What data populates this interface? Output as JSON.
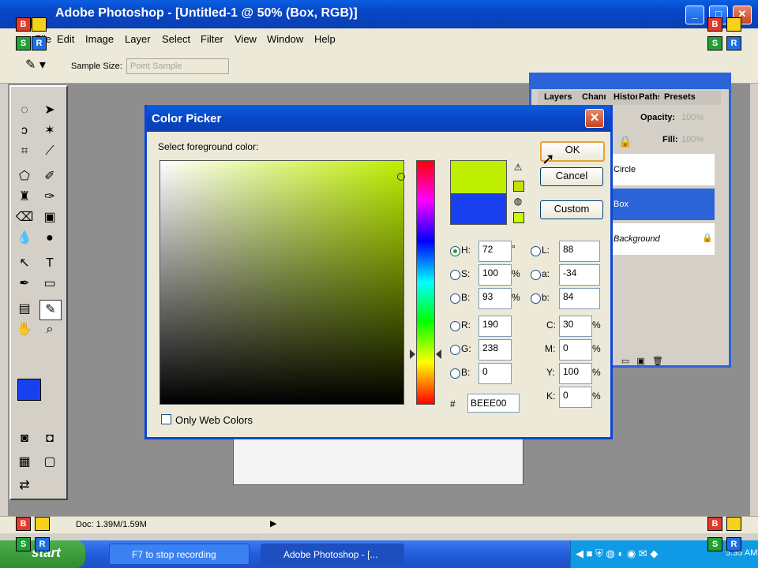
{
  "app": {
    "title": "Adobe Photoshop - [Untitled-1 @ 50% (Box, RGB)]",
    "menus": [
      "File",
      "Edit",
      "Image",
      "Layer",
      "Select",
      "Filter",
      "View",
      "Window",
      "Help"
    ],
    "options": {
      "sample_size_label": "Sample Size:",
      "sample_size_value": "Point Sample"
    },
    "status": {
      "doc": "Doc: 1.39M/1.59M"
    }
  },
  "layers_panel": {
    "tabs": [
      "Layers",
      "Channels",
      "History",
      "Paths",
      "Presets"
    ],
    "opacity_label": "Opacity:",
    "opacity_value": "100%",
    "fill_label": "Fill:",
    "fill_value": "100%",
    "layers": [
      "Circle",
      "Box",
      "Background"
    ]
  },
  "dialog": {
    "title": "Color Picker",
    "select_label": "Select foreground color:",
    "ok": "OK",
    "cancel": "Cancel",
    "custom": "Custom",
    "fields": {
      "h": {
        "label": "H:",
        "value": "72",
        "unit": "°"
      },
      "s": {
        "label": "S:",
        "value": "100",
        "unit": "%"
      },
      "b": {
        "label": "B:",
        "value": "93",
        "unit": "%"
      },
      "r": {
        "label": "R:",
        "value": "190"
      },
      "g": {
        "label": "G:",
        "value": "238"
      },
      "bl": {
        "label": "B:",
        "value": "0"
      },
      "l": {
        "label": "L:",
        "value": "88"
      },
      "a": {
        "label": "a:",
        "value": "-34"
      },
      "b2": {
        "label": "b:",
        "value": "84"
      },
      "c": {
        "label": "C:",
        "value": "30",
        "unit": "%"
      },
      "m": {
        "label": "M:",
        "value": "0",
        "unit": "%"
      },
      "y": {
        "label": "Y:",
        "value": "100",
        "unit": "%"
      },
      "k": {
        "label": "K:",
        "value": "0",
        "unit": "%"
      }
    },
    "hex_label": "#",
    "hex_value": "BEEE00",
    "web_colors_label": "Only Web Colors",
    "new_color": "#beee00",
    "old_color": "#1840ee"
  },
  "taskbar": {
    "start": "start",
    "items": [
      "F7 to stop recording",
      "Adobe Photoshop - [..."
    ],
    "clock": "5:35 AM"
  },
  "markers": {
    "b": "B",
    "s": "S",
    "r": "R"
  }
}
